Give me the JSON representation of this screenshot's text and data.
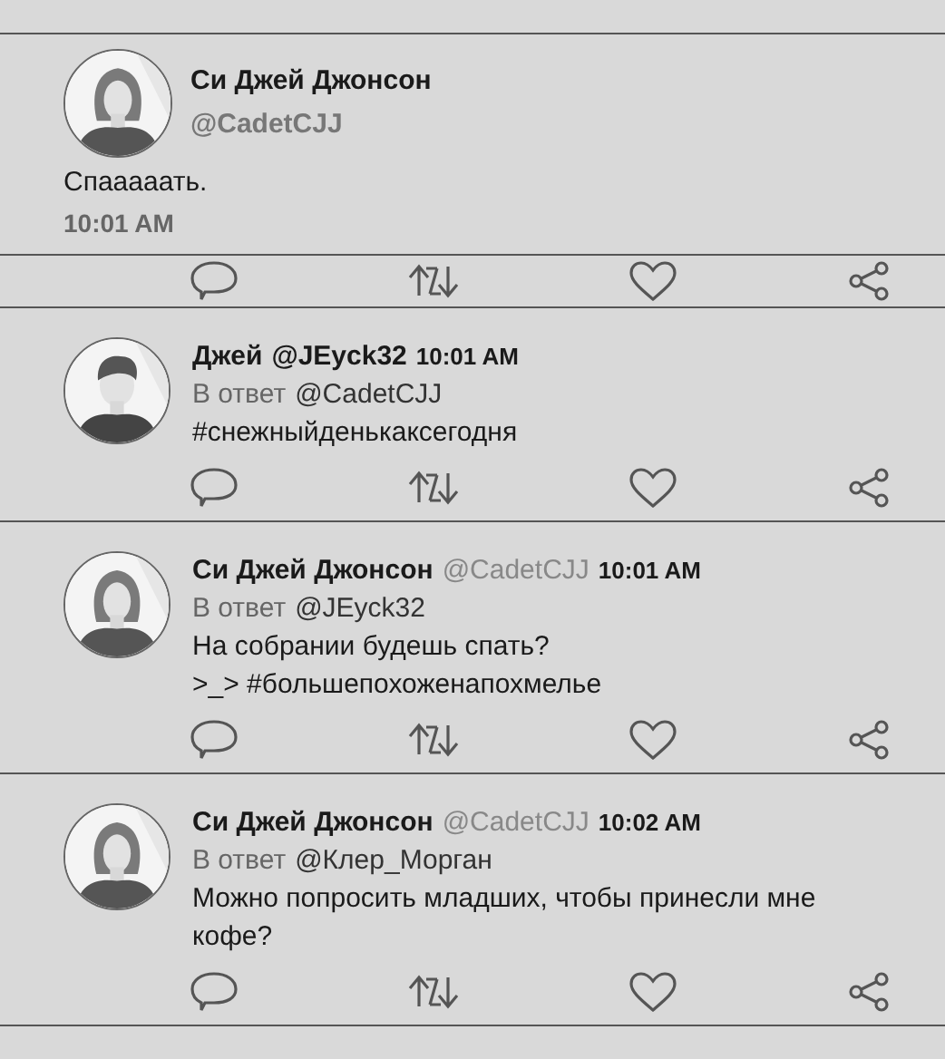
{
  "main_tweet": {
    "avatar": {
      "kind": "female"
    },
    "name": "Си Джей Джонсон",
    "handle": "@CadetCJJ",
    "text": "Спааааать.",
    "time": "10:01 AM"
  },
  "replies": [
    {
      "avatar": {
        "kind": "male"
      },
      "name": "Джей",
      "handle": "@JEyck32",
      "handle_muted": false,
      "time": "10:01 AM",
      "reply_label": "В ответ",
      "reply_to": "@CadetCJJ",
      "lines": [
        "#снежныйденькаксегодня"
      ]
    },
    {
      "avatar": {
        "kind": "female"
      },
      "name": "Си Джей Джонсон",
      "handle": "@CadetCJJ",
      "handle_muted": true,
      "time": "10:01 AM",
      "reply_label": "В ответ",
      "reply_to": "@JEyck32",
      "lines": [
        "На собрании будешь спать?",
        ">_> #большепохоженапохмелье"
      ]
    },
    {
      "avatar": {
        "kind": "female"
      },
      "name": "Си Джей Джонсон",
      "handle": "@CadetCJJ",
      "handle_muted": true,
      "time": "10:02 AM",
      "reply_label": "В ответ",
      "reply_to": "@Клер_Морган",
      "lines": [
        "Можно попросить младших, чтобы принесли мне кофе?"
      ]
    }
  ]
}
